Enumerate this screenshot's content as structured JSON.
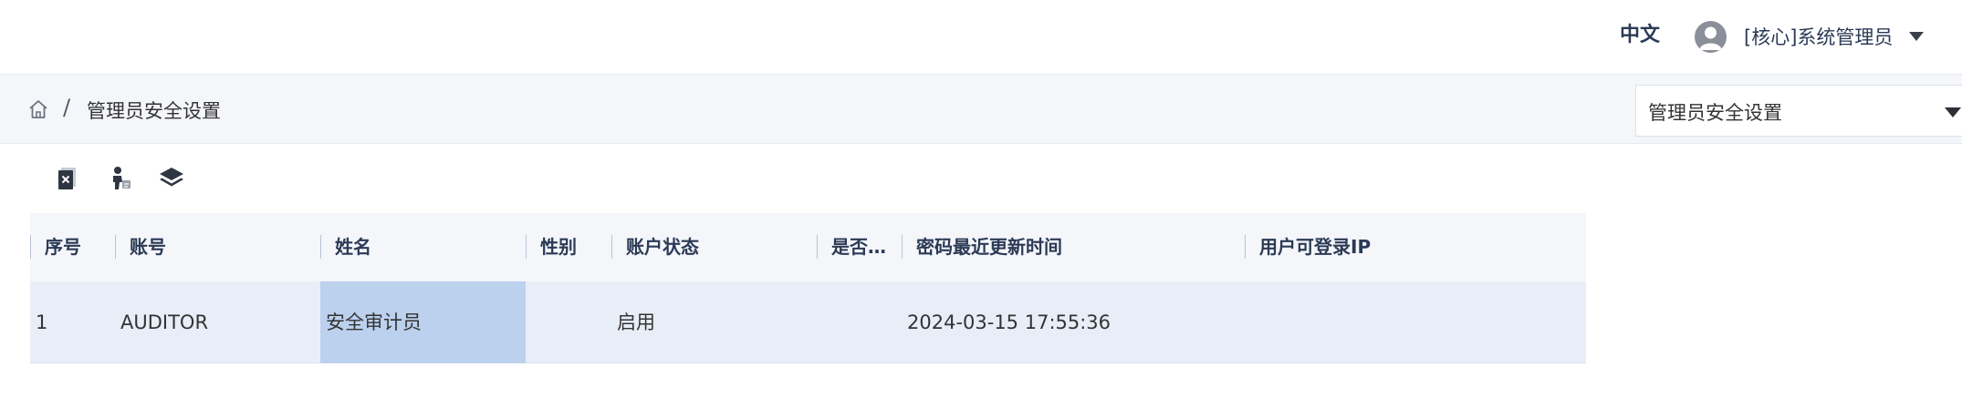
{
  "header": {
    "language": "中文",
    "user_name": "[核心]系统管理员"
  },
  "breadcrumb": {
    "separator": "/",
    "current": "管理员安全设置"
  },
  "page_select": {
    "selected": "管理员安全设置"
  },
  "toolbar": {
    "icons": [
      "delete-document-icon",
      "user-admin-icon",
      "layers-icon"
    ]
  },
  "table": {
    "columns": [
      "序号",
      "账号",
      "姓名",
      "性别",
      "账户状态",
      "是否…",
      "密码最近更新时间",
      "用户可登录IP"
    ],
    "rows": [
      {
        "index": "1",
        "account": "AUDITOR",
        "name": "安全审计员",
        "gender": "",
        "status": "启用",
        "is_flag": "",
        "pwd_updated": "2024-03-15 17:55:36",
        "login_ip": ""
      }
    ]
  },
  "colors": {
    "header_text": "#2b3a55",
    "crumb_bg": "#f4f6fa",
    "row_bg": "#e8eef8",
    "selected_cell": "#bcd1ee"
  }
}
